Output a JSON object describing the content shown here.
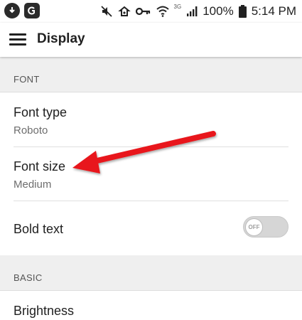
{
  "status_bar": {
    "battery_percent": "100%",
    "time": "5:14 PM",
    "network_type": "3G",
    "icons": [
      "download-icon",
      "app-notification-icon",
      "mute-icon",
      "hotspot-icon",
      "key-icon",
      "wifi-icon",
      "signal-icon",
      "battery-icon"
    ]
  },
  "app_bar": {
    "title": "Display",
    "menu_icon": "hamburger-menu-icon"
  },
  "sections": [
    {
      "header": "FONT",
      "items": [
        {
          "title": "Font type",
          "subtitle": "Roboto"
        },
        {
          "title": "Font size",
          "subtitle": "Medium"
        },
        {
          "title": "Bold text",
          "toggle_label": "OFF",
          "toggle_on": false
        }
      ]
    },
    {
      "header": "BASIC",
      "items": [
        {
          "title": "Brightness"
        }
      ]
    }
  ],
  "annotation": {
    "type": "red-arrow",
    "points_to": "Font size",
    "color": "#e8191a"
  }
}
